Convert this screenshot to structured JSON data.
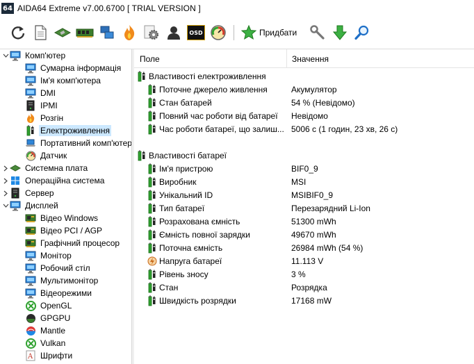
{
  "window": {
    "icon_text": "64",
    "title": "AIDA64 Extreme v7.00.6700  [ TRIAL VERSION ]"
  },
  "toolbar": {
    "buttons": [
      "refresh-icon",
      "report-icon",
      "motherboard-icon",
      "memory-icon",
      "network-icon",
      "flame-icon",
      "gears-icon",
      "user-icon",
      "osd-icon",
      "gauge-icon"
    ],
    "osd_label": "OSD",
    "add_label": "Придбати",
    "extra": [
      "wrench-icon",
      "download-arrow-icon",
      "search-icon"
    ]
  },
  "tree": [
    {
      "label": "Комп'ютер",
      "level": 0,
      "expander": "open",
      "icon": "computer-icon"
    },
    {
      "label": "Сумарна інформація",
      "level": 1,
      "icon": "computer-icon"
    },
    {
      "label": "Ім'я комп'ютера",
      "level": 1,
      "icon": "computer-icon"
    },
    {
      "label": "DMI",
      "level": 1,
      "icon": "computer-icon"
    },
    {
      "label": "IPMI",
      "level": 1,
      "icon": "server-icon"
    },
    {
      "label": "Розгін",
      "level": 1,
      "icon": "flame-icon"
    },
    {
      "label": "Електроживлення",
      "level": 1,
      "icon": "battery-icon",
      "selected": true
    },
    {
      "label": "Портативний комп'ютер",
      "level": 1,
      "icon": "laptop-icon"
    },
    {
      "label": "Датчик",
      "level": 1,
      "icon": "gauge-icon"
    },
    {
      "label": "Системна плата",
      "level": 0,
      "expander": "closed",
      "icon": "motherboard-icon"
    },
    {
      "label": "Операційна система",
      "level": 0,
      "expander": "closed",
      "icon": "windows-icon"
    },
    {
      "label": "Сервер",
      "level": 0,
      "expander": "closed",
      "icon": "server-icon"
    },
    {
      "label": "Дисплей",
      "level": 0,
      "expander": "open",
      "icon": "computer-icon"
    },
    {
      "label": "Відео Windows",
      "level": 1,
      "icon": "video-card-icon"
    },
    {
      "label": "Відео PCI / AGP",
      "level": 1,
      "icon": "video-card-icon"
    },
    {
      "label": "Графічний процесор",
      "level": 1,
      "icon": "video-card-icon"
    },
    {
      "label": "Монітор",
      "level": 1,
      "icon": "computer-icon"
    },
    {
      "label": "Робочий стіл",
      "level": 1,
      "icon": "computer-icon"
    },
    {
      "label": "Мультимонітор",
      "level": 1,
      "icon": "computer-icon"
    },
    {
      "label": "Відеорежими",
      "level": 1,
      "icon": "computer-icon"
    },
    {
      "label": "OpenGL",
      "level": 1,
      "icon": "xbox-icon"
    },
    {
      "label": "GPGPU",
      "level": 1,
      "icon": "gpgpu-icon"
    },
    {
      "label": "Mantle",
      "level": 1,
      "icon": "mantle-icon"
    },
    {
      "label": "Vulkan",
      "level": 1,
      "icon": "xbox-icon"
    },
    {
      "label": "Шрифти",
      "level": 1,
      "icon": "font-icon"
    }
  ],
  "columns": {
    "field": "Поле",
    "value": "Значення"
  },
  "rows": [
    {
      "type": "group",
      "field": "Властивості електроживлення",
      "icon": "battery-icon"
    },
    {
      "type": "item",
      "field": "Поточне джерело живлення",
      "value": "Акумулятор",
      "icon": "battery-icon"
    },
    {
      "type": "item",
      "field": "Стан батарей",
      "value": "54 % (Невідомо)",
      "icon": "battery-icon"
    },
    {
      "type": "item",
      "field": "Повний час роботи від батареї",
      "value": "Невідомо",
      "icon": "battery-icon"
    },
    {
      "type": "item",
      "field": "Час роботи батареї, що залиш...",
      "value": "5006 с (1 годин, 23 хв, 26 с)",
      "icon": "battery-icon"
    },
    {
      "type": "blank"
    },
    {
      "type": "group",
      "field": "Властивості батареї",
      "icon": "battery-icon"
    },
    {
      "type": "item",
      "field": "Ім'я пристрою",
      "value": "BIF0_9",
      "icon": "battery-icon"
    },
    {
      "type": "item",
      "field": "Виробник",
      "value": "MSI",
      "icon": "battery-icon"
    },
    {
      "type": "item",
      "field": "Унікальний ID",
      "value": "MSIBIF0_9",
      "icon": "battery-icon"
    },
    {
      "type": "item",
      "field": "Тип батареї",
      "value": "Перезарядний Li-Ion",
      "icon": "battery-icon"
    },
    {
      "type": "item",
      "field": "Розрахована ємність",
      "value": "51300 mWh",
      "icon": "battery-icon"
    },
    {
      "type": "item",
      "field": "Ємність повної зарядки",
      "value": "49670 mWh",
      "icon": "battery-icon"
    },
    {
      "type": "item",
      "field": "Поточна ємність",
      "value": "26984 mWh  (54 %)",
      "icon": "battery-icon"
    },
    {
      "type": "item",
      "field": "Напруга батареї",
      "value": "11.113 V",
      "icon": "voltage-icon"
    },
    {
      "type": "item",
      "field": "Рівень зносу",
      "value": "3 %",
      "icon": "battery-icon"
    },
    {
      "type": "item",
      "field": "Стан",
      "value": "Розрядка",
      "icon": "battery-icon"
    },
    {
      "type": "item",
      "field": "Швидкість розрядки",
      "value": "17168 mW",
      "icon": "battery-icon"
    }
  ],
  "colors": {
    "selection": "#cce8ff",
    "battery_green": "#2fa12f",
    "accent_green": "#3cb043"
  }
}
